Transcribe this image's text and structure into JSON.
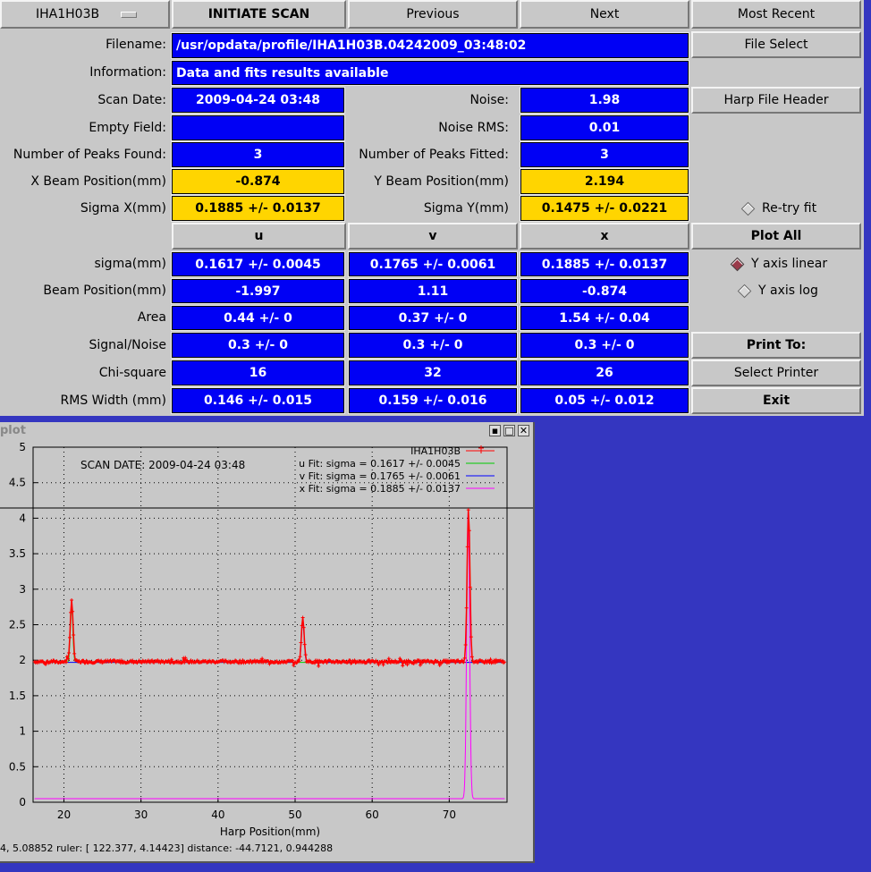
{
  "toolbar": {
    "harp_menu": "IHA1H03B",
    "initiate": "INITIATE SCAN",
    "previous": "Previous",
    "next": "Next",
    "most_recent": "Most Recent",
    "file_select": "File Select",
    "harp_header": "Harp File Header",
    "plot_all": "Plot All",
    "print_to": "Print To:",
    "select_printer": "Select Printer",
    "exit": "Exit"
  },
  "labels": {
    "filename": "Filename:",
    "information": "Information:",
    "scan_date": "Scan Date:",
    "empty_field": "Empty Field:",
    "peaks_found": "Number of Peaks Found:",
    "x_beam": "X Beam Position(mm)",
    "sigma_x": "Sigma X(mm)",
    "noise": "Noise:",
    "noise_rms": "Noise RMS:",
    "peaks_fitted": "Number of Peaks Fitted:",
    "y_beam": "Y Beam Position(mm)",
    "sigma_y": "Sigma Y(mm)",
    "sigma": "sigma(mm)",
    "beam_pos": "Beam Position(mm)",
    "area": "Area",
    "snr": "Signal/Noise",
    "chi": "Chi-square",
    "rms": "RMS Width (mm)"
  },
  "values": {
    "filename": "/usr/opdata/profile/IHA1H03B.04242009_03:48:02",
    "information": "Data and fits results available",
    "scan_date": "2009-04-24   03:48",
    "empty_field": "",
    "peaks_found": "3",
    "x_beam": "-0.874",
    "sigma_x": "0.1885 +/- 0.0137",
    "noise": "1.98",
    "noise_rms": "0.01",
    "peaks_fitted": "3",
    "y_beam": "2.194",
    "sigma_y": "0.1475 +/- 0.0221"
  },
  "table": {
    "columns": [
      "u",
      "v",
      "x"
    ],
    "rows": [
      {
        "sigma": [
          "0.1617 +/- 0.0045",
          "0.1765 +/- 0.0061",
          "0.1885 +/- 0.0137"
        ]
      },
      {
        "beam_pos": [
          "-1.997",
          "1.11",
          "-0.874"
        ]
      },
      {
        "area": [
          "0.44 +/- 0",
          "0.37 +/- 0",
          "1.54 +/- 0.04"
        ]
      },
      {
        "snr": [
          "0.3 +/- 0",
          "0.3 +/- 0",
          "0.3 +/- 0"
        ]
      },
      {
        "chi": [
          "16",
          "32",
          "26"
        ]
      },
      {
        "rms": [
          "0.146 +/- 0.015",
          "0.159 +/- 0.016",
          "0.05 +/- 0.012"
        ]
      }
    ]
  },
  "options": {
    "retry_fit": "Re-try fit",
    "y_linear": "Y axis linear",
    "y_log": "Y axis log",
    "y_linear_selected": true,
    "retry_selected": false
  },
  "plot_window": {
    "title": "plot",
    "status": "4,  5.08852  ruler: [ 122.377,  4.14423]  distance: -44.7121,  0.944288"
  },
  "chart_data": {
    "type": "line",
    "xlabel": "Harp Position(mm)",
    "annotation": "SCAN DATE: 2009-04-24   03:48",
    "xlim": [
      16,
      77.5
    ],
    "ylim": [
      0,
      5
    ],
    "xticks": [
      20,
      30,
      40,
      50,
      60,
      70
    ],
    "yticks": [
      0,
      0.5,
      1,
      1.5,
      2,
      2.5,
      3,
      3.5,
      4,
      4.5,
      5
    ],
    "grid": "dotted",
    "legend_position": "top-right",
    "ruler_y": 4.14423,
    "series": [
      {
        "name": "IHA1H03B",
        "color": "#ff0000",
        "marker": "plus",
        "baseline": 1.98,
        "noise": 0.02,
        "x_range": [
          16.2,
          77.2
        ],
        "peaks": [
          {
            "x": 21.0,
            "y": 2.85
          },
          {
            "x": 51.0,
            "y": 2.6
          },
          {
            "x": 72.5,
            "y": 4.15
          }
        ]
      },
      {
        "name": "u  Fit: sigma = 0.1617 +/- 0.0045",
        "color": "#00cc00",
        "baseline": 1.97,
        "peaks": [
          {
            "x": 21.0,
            "y": 2.75,
            "sigma": 0.1617
          }
        ]
      },
      {
        "name": "v  Fit: sigma = 0.1765 +/- 0.0061",
        "color": "#0000ff",
        "baseline": 1.97,
        "peaks": [
          {
            "x": 51.0,
            "y": 2.55,
            "sigma": 0.1765
          }
        ]
      },
      {
        "name": "x  Fit: sigma = 0.1885 +/- 0.0137",
        "color": "#ff00ff",
        "baseline": 0.05,
        "peaks": [
          {
            "x": 72.45,
            "y": 4.1,
            "sigma": 0.1885
          }
        ]
      }
    ]
  }
}
